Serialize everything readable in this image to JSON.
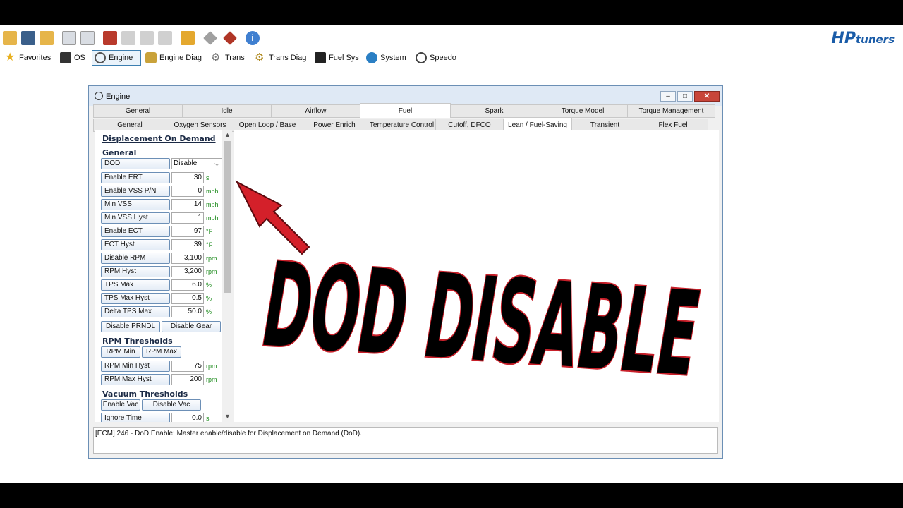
{
  "toolbar": {
    "logo_hp": "HP",
    "logo_tuners": "tuners",
    "nav": [
      {
        "label": "Favorites",
        "icon": "star-icon"
      },
      {
        "label": "OS",
        "icon": "chip-icon"
      },
      {
        "label": "Engine",
        "icon": "engine-icon"
      },
      {
        "label": "Engine Diag",
        "icon": "engine-diag-icon"
      },
      {
        "label": "Trans",
        "icon": "gear-icon"
      },
      {
        "label": "Trans Diag",
        "icon": "gear-diag-icon"
      },
      {
        "label": "Fuel Sys",
        "icon": "fuel-pump-icon"
      },
      {
        "label": "System",
        "icon": "globe-icon"
      },
      {
        "label": "Speedo",
        "icon": "speedometer-icon"
      }
    ]
  },
  "window": {
    "title": "Engine",
    "tabs_row1": [
      "General",
      "Idle",
      "Airflow",
      "Fuel",
      "Spark",
      "Torque Model",
      "Torque Management"
    ],
    "tabs_row1_selected": "Fuel",
    "tabs_row2": [
      "General",
      "Oxygen Sensors",
      "Open Loop / Base",
      "Power Enrich",
      "Temperature Control",
      "Cutoff, DFCO",
      "Lean / Fuel-Saving",
      "Transient",
      "Flex Fuel"
    ],
    "tabs_row2_selected": "Lean / Fuel-Saving"
  },
  "panel": {
    "heading": "Displacement On Demand",
    "general_heading": "General",
    "dod_label": "DOD",
    "dod_value": "Disable",
    "rows": [
      {
        "label": "Enable ERT",
        "value": "30",
        "unit": "s"
      },
      {
        "label": "Enable VSS P/N",
        "value": "0",
        "unit": "mph"
      },
      {
        "label": "Min VSS",
        "value": "14",
        "unit": "mph"
      },
      {
        "label": "Min VSS Hyst",
        "value": "1",
        "unit": "mph"
      },
      {
        "label": "Enable ECT",
        "value": "97",
        "unit": "°F"
      },
      {
        "label": "ECT Hyst",
        "value": "39",
        "unit": "°F"
      },
      {
        "label": "Disable RPM",
        "value": "3,100",
        "unit": "rpm"
      },
      {
        "label": "RPM Hyst",
        "value": "3,200",
        "unit": "rpm"
      },
      {
        "label": "TPS Max",
        "value": "6.0",
        "unit": "%"
      },
      {
        "label": "TPS Max Hyst",
        "value": "0.5",
        "unit": "%"
      },
      {
        "label": "Delta TPS Max",
        "value": "50.0",
        "unit": "%"
      }
    ],
    "disable_prndl": "Disable PRNDL",
    "disable_gear": "Disable Gear",
    "rpm_thresholds_heading": "RPM Thresholds",
    "rpm_min": "RPM Min",
    "rpm_max": "RPM Max",
    "rpm_rows": [
      {
        "label": "RPM Min Hyst",
        "value": "75",
        "unit": "rpm"
      },
      {
        "label": "RPM Max Hyst",
        "value": "200",
        "unit": "rpm"
      }
    ],
    "vacuum_heading": "Vacuum Thresholds",
    "enable_vac": "Enable Vac",
    "disable_vac": "Disable Vac",
    "ignore_time": {
      "label": "Ignore Time",
      "value": "0.0",
      "unit": "s"
    }
  },
  "status": "[ECM] 246 - DoD Enable: Master enable/disable for Displacement on Demand (DoD).",
  "overlay": {
    "text": "DOD DISABLE"
  }
}
